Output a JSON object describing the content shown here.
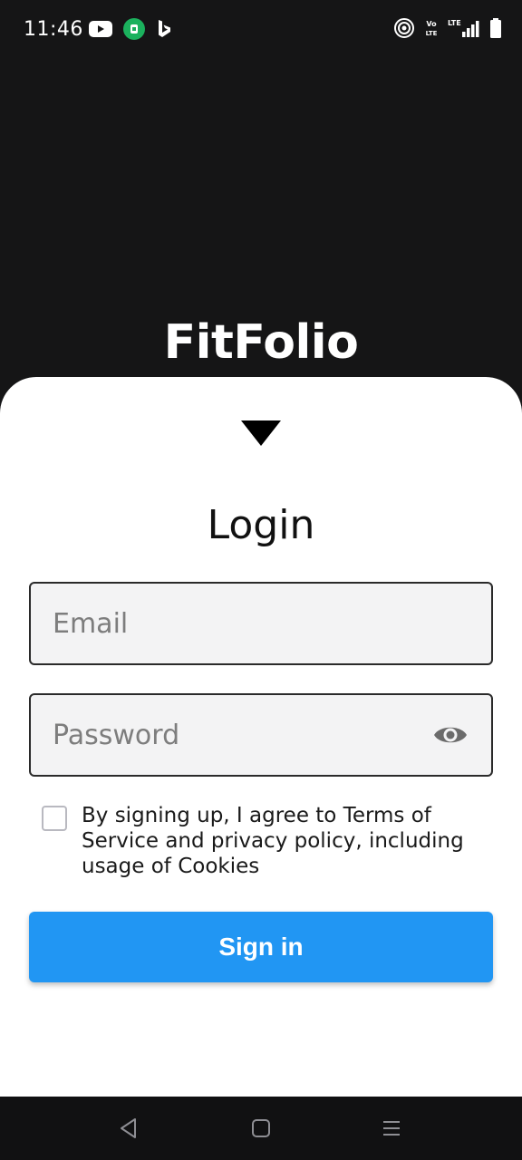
{
  "status_bar": {
    "time": "11:46",
    "left_icons": [
      "youtube-icon",
      "app-notification-icon",
      "bing-icon"
    ],
    "right_icons": [
      "hotspot-icon",
      "volte-icon",
      "lte-signal-icon",
      "battery-icon"
    ],
    "volte_text": "Vo LTE",
    "lte_text": "LTE"
  },
  "app": {
    "title": "FitFolio"
  },
  "login": {
    "heading": "Login",
    "email_placeholder": "Email",
    "password_placeholder": "Password",
    "terms_text": "By signing up, I agree to Terms of Service and privacy policy, including usage of Cookies",
    "terms_checked": false,
    "signin_label": "Sign in"
  },
  "colors": {
    "background_dark": "#151516",
    "sheet": "#ffffff",
    "field_bg": "#f3f3f4",
    "primary_button": "#2196f3"
  },
  "nav_bar": {
    "buttons": [
      "back-icon",
      "home-icon",
      "recents-icon"
    ]
  }
}
